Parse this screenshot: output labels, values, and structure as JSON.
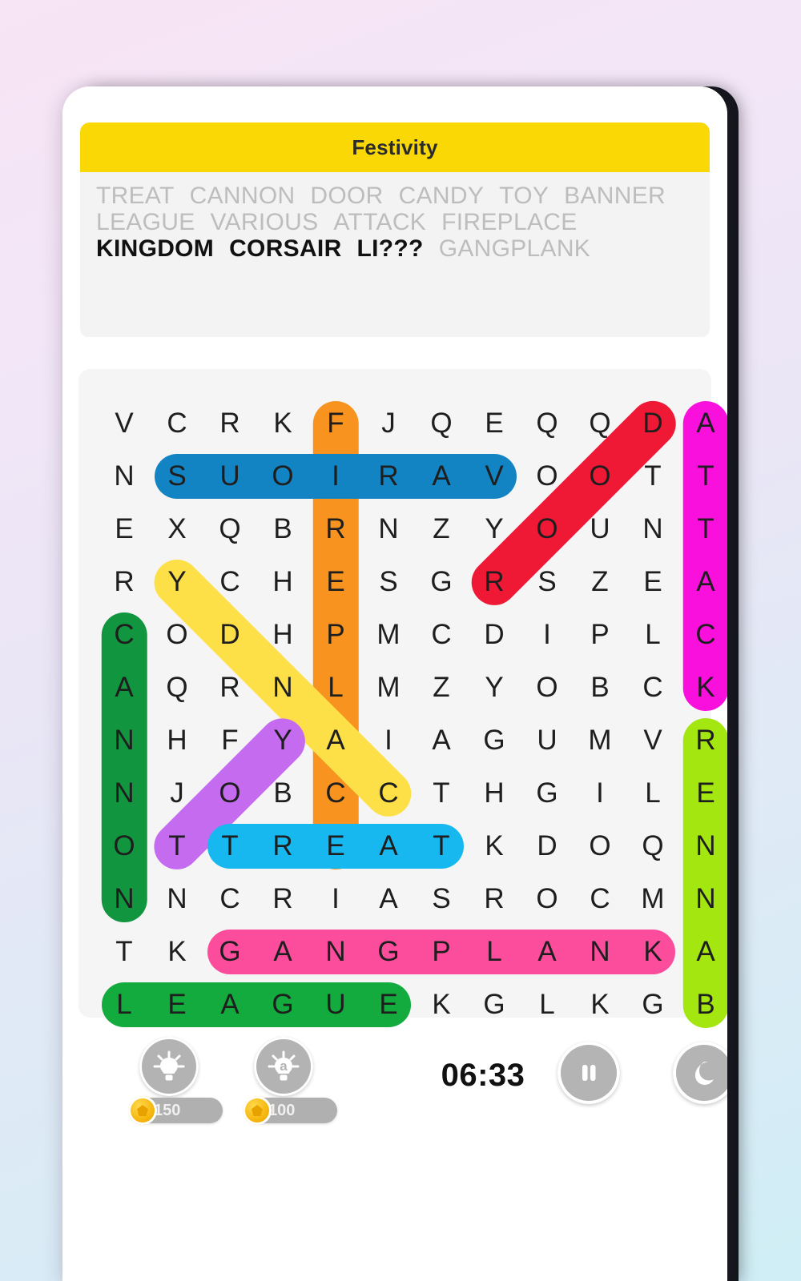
{
  "app": {
    "title": "Festivity"
  },
  "wordlist": {
    "words": [
      {
        "text": "TREAT",
        "found": true
      },
      {
        "text": "CANNON",
        "found": true
      },
      {
        "text": "DOOR",
        "found": true
      },
      {
        "text": "CANDY",
        "found": true
      },
      {
        "text": "TOY",
        "found": true
      },
      {
        "text": "BANNER",
        "found": true
      },
      {
        "text": "LEAGUE",
        "found": true
      },
      {
        "text": "VARIOUS",
        "found": true
      },
      {
        "text": "ATTACK",
        "found": true
      },
      {
        "text": "FIREPLACE",
        "found": true
      },
      {
        "text": "KINGDOM",
        "found": false
      },
      {
        "text": "CORSAIR",
        "found": false
      },
      {
        "text": "LI???",
        "found": false
      },
      {
        "text": "GANGPLANK",
        "found": true
      }
    ]
  },
  "grid": {
    "rows": 12,
    "cols": 12,
    "letters": [
      [
        "V",
        "C",
        "R",
        "K",
        "F",
        "J",
        "Q",
        "E",
        "Q",
        "Q",
        "D",
        "A"
      ],
      [
        "N",
        "S",
        "U",
        "O",
        "I",
        "R",
        "A",
        "V",
        "O",
        "O",
        "T",
        "T"
      ],
      [
        "E",
        "X",
        "Q",
        "B",
        "R",
        "N",
        "Z",
        "Y",
        "O",
        "U",
        "N",
        "T"
      ],
      [
        "R",
        "Y",
        "C",
        "H",
        "E",
        "S",
        "G",
        "R",
        "S",
        "Z",
        "E",
        "A"
      ],
      [
        "C",
        "O",
        "D",
        "H",
        "P",
        "M",
        "C",
        "D",
        "I",
        "P",
        "L",
        "C"
      ],
      [
        "A",
        "Q",
        "R",
        "N",
        "L",
        "M",
        "Z",
        "Y",
        "O",
        "B",
        "C",
        "K"
      ],
      [
        "N",
        "H",
        "F",
        "Y",
        "A",
        "I",
        "A",
        "G",
        "U",
        "M",
        "V",
        "R"
      ],
      [
        "N",
        "J",
        "O",
        "B",
        "C",
        "C",
        "T",
        "H",
        "G",
        "I",
        "L",
        "E"
      ],
      [
        "O",
        "T",
        "T",
        "R",
        "E",
        "A",
        "T",
        "K",
        "D",
        "O",
        "Q",
        "N"
      ],
      [
        "N",
        "N",
        "C",
        "R",
        "I",
        "A",
        "S",
        "R",
        "O",
        "C",
        "M",
        "N"
      ],
      [
        "T",
        "K",
        "G",
        "A",
        "N",
        "G",
        "P",
        "L",
        "A",
        "N",
        "K",
        "A"
      ],
      [
        "L",
        "E",
        "A",
        "G",
        "U",
        "E",
        "K",
        "G",
        "L",
        "K",
        "G",
        "B"
      ]
    ],
    "highlights": [
      {
        "word": "FIREPLACE",
        "color": "#f7931e",
        "start": [
          0,
          4
        ],
        "end": [
          8,
          4
        ]
      },
      {
        "word": "VARIOUS",
        "color": "#1283c3",
        "start": [
          1,
          1
        ],
        "end": [
          1,
          7
        ]
      },
      {
        "word": "DOOR",
        "color": "#ef1935",
        "start": [
          0,
          10
        ],
        "end": [
          3,
          7
        ]
      },
      {
        "word": "ATTACK",
        "color": "#f910dd",
        "start": [
          0,
          11
        ],
        "end": [
          5,
          11
        ]
      },
      {
        "word": "CANDY",
        "color": "#fde047",
        "start": [
          3,
          1
        ],
        "end": [
          7,
          5
        ]
      },
      {
        "word": "CANNON",
        "color": "#11963f",
        "start": [
          4,
          0
        ],
        "end": [
          9,
          0
        ]
      },
      {
        "word": "TOY",
        "color": "#c56bf0",
        "start": [
          8,
          1
        ],
        "end": [
          6,
          3
        ]
      },
      {
        "word": "TREAT",
        "color": "#17b8f0",
        "start": [
          8,
          2
        ],
        "end": [
          8,
          6
        ]
      },
      {
        "word": "BANNER",
        "color": "#a4e610",
        "start": [
          6,
          11
        ],
        "end": [
          11,
          11
        ]
      },
      {
        "word": "GANGPLANK",
        "color": "#fc4d9c",
        "start": [
          10,
          2
        ],
        "end": [
          10,
          10
        ]
      },
      {
        "word": "LEAGUE",
        "color": "#13aa3e",
        "start": [
          11,
          0
        ],
        "end": [
          11,
          5
        ]
      }
    ]
  },
  "toolbar": {
    "hint_letter": {
      "icon": "lightbulb-icon",
      "cost": "150"
    },
    "hint_word": {
      "icon": "lightbulb-letter-icon",
      "cost": "100"
    },
    "timer": "06:33",
    "pause": {
      "icon": "pause-icon"
    },
    "night": {
      "icon": "moon-icon"
    }
  },
  "colors": {
    "banner": "#f9d806",
    "panel": "#f3f3f3",
    "grid_bg": "#f5f5f6",
    "found_word": "#bdbdbd",
    "todo_word": "#111111"
  }
}
